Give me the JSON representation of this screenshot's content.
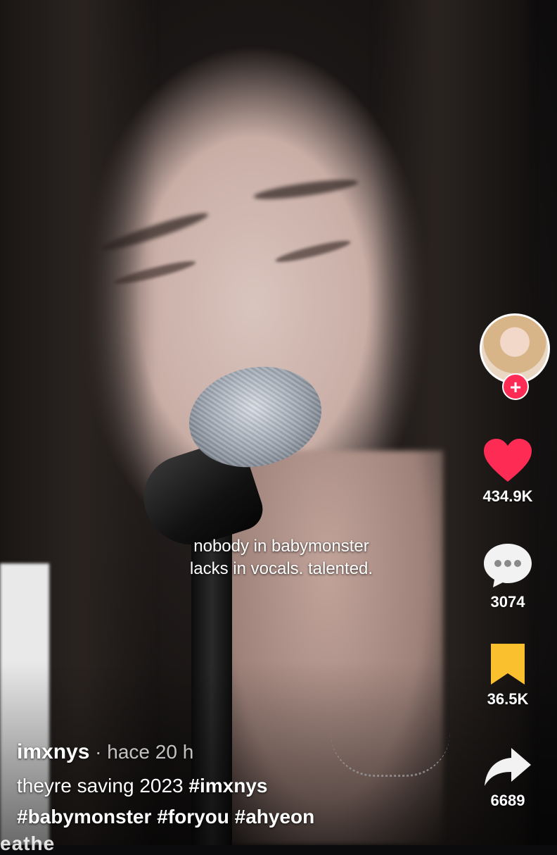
{
  "caption": {
    "line1": "nobody in babymonster",
    "line2": "lacks in vocals. talented."
  },
  "rail": {
    "follow_label": "+",
    "like_count": "434.9K",
    "comment_count": "3074",
    "save_count": "36.5K",
    "share_count": "6689"
  },
  "post": {
    "username": "imxnys",
    "separator": " · ",
    "timestamp": "hace 20 h",
    "description": "theyre saving 2023",
    "hashtags": [
      "#imxnys",
      "#babymonster",
      "#foryou",
      "#ahyeon"
    ]
  },
  "music_text": "eathe",
  "colors": {
    "like": "#fe2c55",
    "save": "#fbc02d",
    "follow": "#fe2c55",
    "text": "#ffffff"
  },
  "icons": [
    "heart-icon",
    "comment-icon",
    "bookmark-icon",
    "share-icon",
    "plus-icon"
  ]
}
